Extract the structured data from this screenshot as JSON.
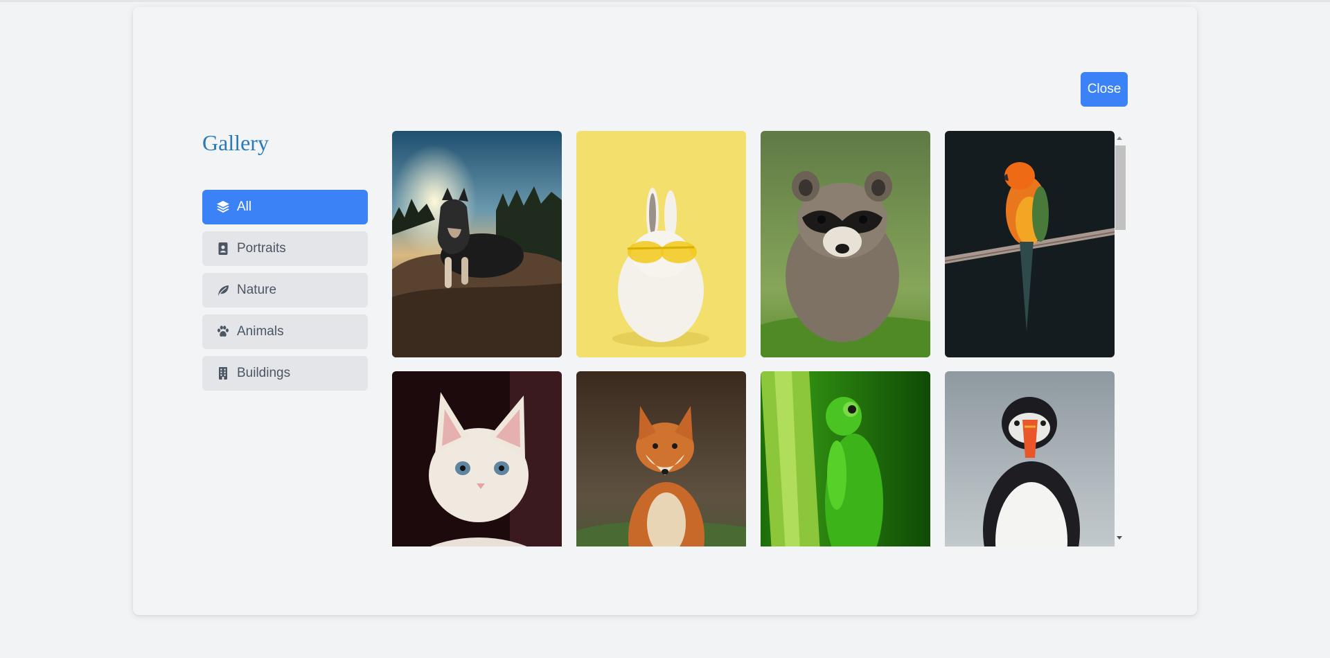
{
  "header": {
    "close_label": "Close"
  },
  "gallery": {
    "title": "Gallery",
    "categories": [
      {
        "label": "All",
        "icon": "layers-icon",
        "active": true
      },
      {
        "label": "Portraits",
        "icon": "portrait-icon",
        "active": false
      },
      {
        "label": "Nature",
        "icon": "leaf-icon",
        "active": false
      },
      {
        "label": "Animals",
        "icon": "paw-icon",
        "active": false
      },
      {
        "label": "Buildings",
        "icon": "building-icon",
        "active": false
      }
    ],
    "images": [
      {
        "subject": "dog"
      },
      {
        "subject": "rabbit"
      },
      {
        "subject": "raccoon"
      },
      {
        "subject": "parrot"
      },
      {
        "subject": "kitten"
      },
      {
        "subject": "fox"
      },
      {
        "subject": "frog"
      },
      {
        "subject": "puffin"
      }
    ]
  },
  "colors": {
    "accent": "#3b82f6",
    "title": "#2a7ab8"
  }
}
